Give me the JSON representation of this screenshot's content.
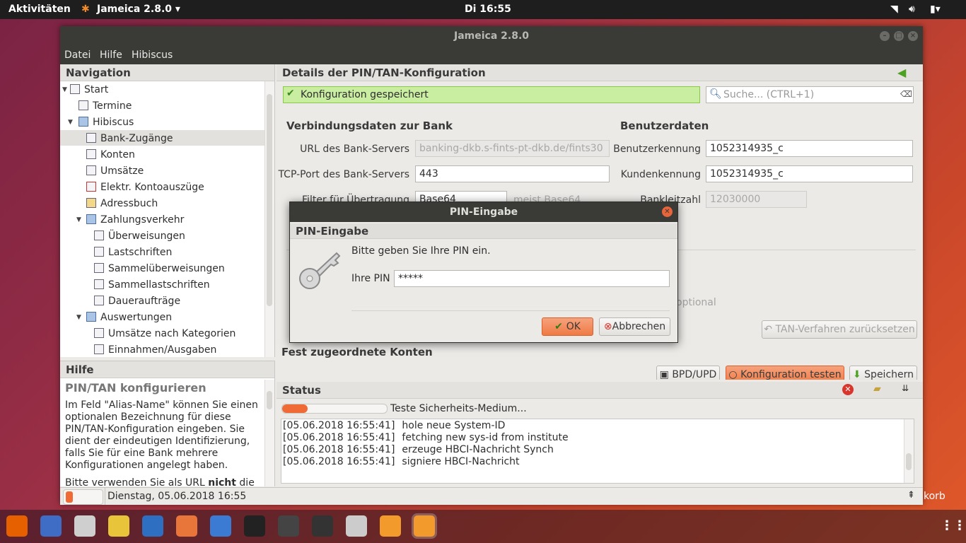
{
  "topbar": {
    "activities": "Aktivitäten",
    "app_menu": "Jameica 2.8.0 ▾",
    "clock": "Di 16:55"
  },
  "window": {
    "title": "Jameica 2.8.0"
  },
  "menu": {
    "items": [
      "Datei",
      "Hilfe",
      "Hibiscus"
    ]
  },
  "navigation": {
    "header": "Navigation",
    "items": [
      {
        "label": "Start"
      },
      {
        "label": "Termine"
      },
      {
        "label": "Hibiscus"
      },
      {
        "label": "Bank-Zugänge"
      },
      {
        "label": "Konten"
      },
      {
        "label": "Umsätze"
      },
      {
        "label": "Elektr. Kontoauszüge"
      },
      {
        "label": "Adressbuch"
      },
      {
        "label": "Zahlungsverkehr"
      },
      {
        "label": "Überweisungen"
      },
      {
        "label": "Lastschriften"
      },
      {
        "label": "Sammelüberweisungen"
      },
      {
        "label": "Sammellastschriften"
      },
      {
        "label": "Daueraufträge"
      },
      {
        "label": "Auswertungen"
      },
      {
        "label": "Umsätze nach Kategorien"
      },
      {
        "label": "Einnahmen/Ausgaben"
      }
    ]
  },
  "help": {
    "header": "Hilfe",
    "title": "PIN/TAN konfigurieren",
    "body": "Im Feld \"Alias-Name\" können Sie einen optionalen Bezeichnung für diese PIN/TAN-Konfiguration eingeben. Sie dient der eindeutigen Identifizierung, falls Sie für eine Bank mehrere Konfigurationen angelegt haben.",
    "body2_a": "Bitte verwenden Sie als URL ",
    "body2_b": "nicht",
    "body2_c": " die"
  },
  "details": {
    "header": "Details der PIN/TAN-Konfiguration",
    "saved_msg": "Konfiguration gespeichert",
    "search_placeholder": "Suche...  (CTRL+1)",
    "bank_section": "Verbindungsdaten zur Bank",
    "user_section": "Benutzerdaten",
    "url_label": "URL des Bank-Servers",
    "url_value": "banking-dkb.s-fints-pt-dkb.de/fints30",
    "port_label": "TCP-Port des Bank-Servers",
    "port_value": "443",
    "filter_label": "Filter für Übertragung",
    "filter_value": "Base64",
    "filter_hint": "meist Base64",
    "user_label": "Benutzerkennung",
    "user_value": "1052314935_c",
    "customer_label": "Kundenkennung",
    "customer_value": "1052314935_c",
    "blz_label": "Bankleitzahl",
    "blz_value": "12030000",
    "optional_hint": "optional",
    "tan_reset": "TAN-Verfahren zurücksetzen",
    "accounts_section": "Fest zugeordnete Konten",
    "btn_bpd": "BPD/UPD",
    "btn_test": "Konfiguration testen",
    "btn_save": "Speichern"
  },
  "status": {
    "header": "Status",
    "progress_text": "Teste Sicherheits-Medium...",
    "progress_fraction": 0.24,
    "log": [
      {
        "time": "[05.06.2018 16:55:41]",
        "msg": "hole neue System-ID"
      },
      {
        "time": "[05.06.2018 16:55:41]",
        "msg": "fetching new sys-id from institute"
      },
      {
        "time": "[05.06.2018 16:55:41]",
        "msg": "erzeuge HBCI-Nachricht Synch"
      },
      {
        "time": "[05.06.2018 16:55:41]",
        "msg": "signiere HBCI-Nachricht"
      }
    ]
  },
  "statusbar": {
    "datetime": "Dienstag, 05.06.2018 16:55",
    "trash_label": "korb"
  },
  "dialog": {
    "title": "PIN-Eingabe",
    "header": "PIN-Eingabe",
    "message": "Bitte geben Sie Ihre PIN ein.",
    "pin_label": "Ihre PIN",
    "pin_value": "*****",
    "ok": "OK",
    "cancel": "Abbrechen"
  },
  "colors": {
    "accent": "#e95420",
    "success_bg": "#c9eda1",
    "error": "#d9352c"
  },
  "dock_icons": [
    "firefox-icon",
    "thunderbird-icon",
    "files-icon",
    "rhythmbox-icon",
    "writer-icon",
    "software-center-icon",
    "help-icon",
    "amazon-icon",
    "settings-icon",
    "terminal-icon",
    "screenshot-icon",
    "jameica-icon",
    "jameica-active-icon"
  ]
}
